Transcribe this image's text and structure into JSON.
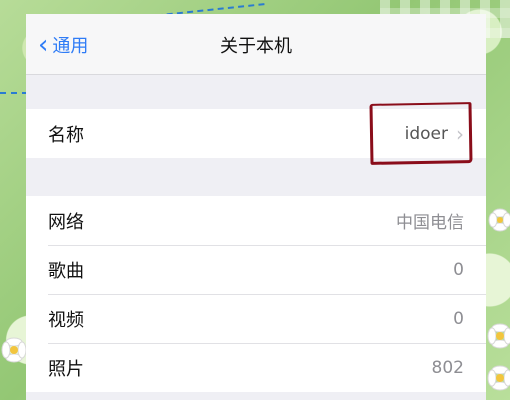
{
  "nav": {
    "back_label": "通用",
    "title": "关于本机"
  },
  "rows": [
    {
      "label": "名称",
      "value": "idoer",
      "chevron": true
    },
    {
      "label": "网络",
      "value": "中国电信"
    },
    {
      "label": "歌曲",
      "value": "0"
    },
    {
      "label": "视频",
      "value": "0"
    },
    {
      "label": "照片",
      "value": "802"
    }
  ],
  "colors": {
    "accent": "#2f7cf6",
    "highlight_marker": "#8a0d1a",
    "background": "#a9cf8f"
  }
}
